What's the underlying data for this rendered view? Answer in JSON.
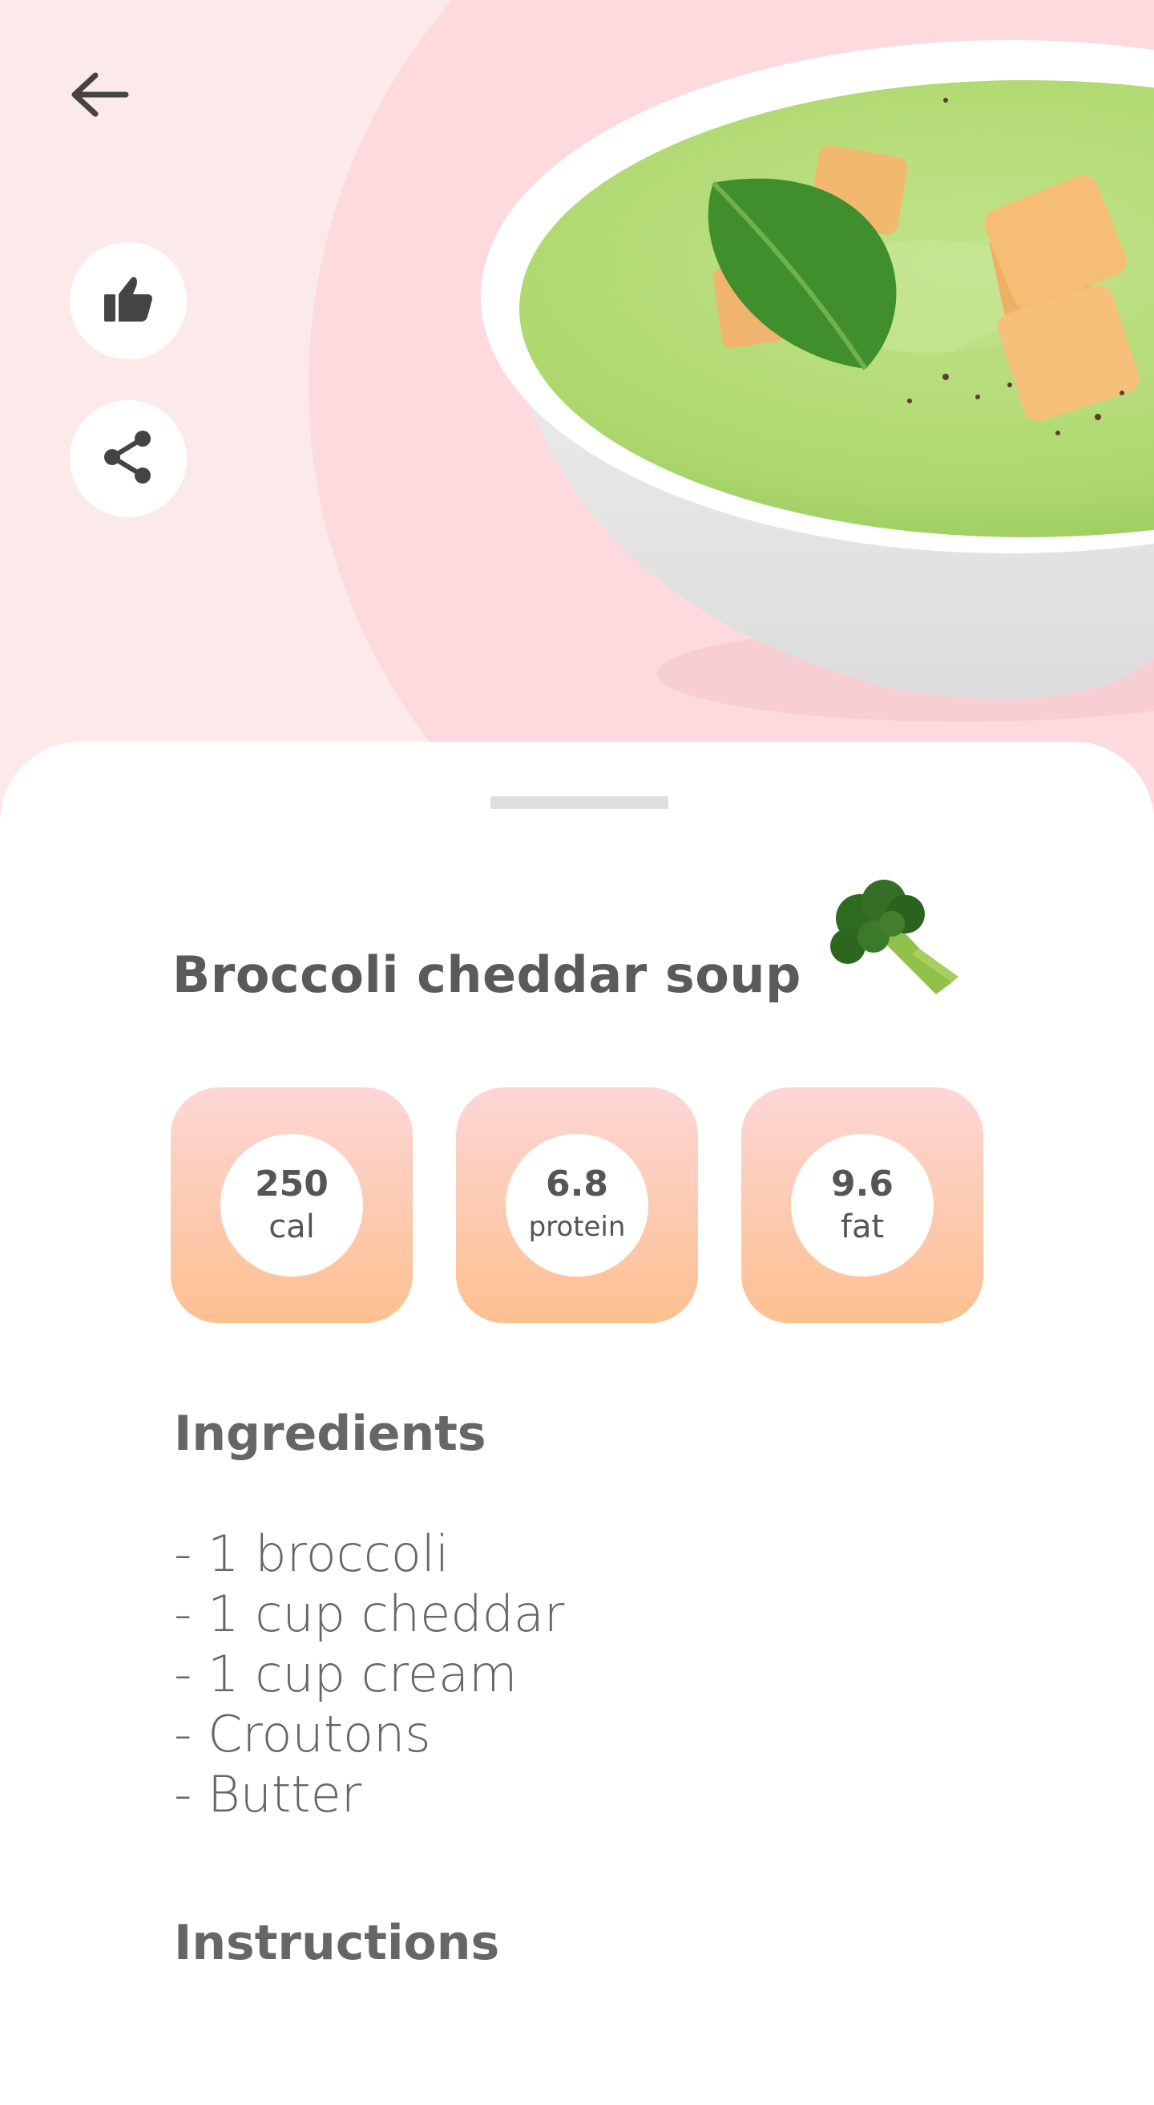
{
  "recipe": {
    "title": "Broccoli cheddar soup",
    "stats": [
      {
        "value": "250",
        "unit": "cal"
      },
      {
        "value": "6.8",
        "unit": "protein"
      },
      {
        "value": "9.6",
        "unit": "fat"
      }
    ]
  },
  "ingredients": {
    "heading": "Ingredients",
    "items": [
      "- 1 broccoli",
      "- 1 cup cheddar",
      "- 1 cup cream",
      "- Croutons",
      "- Butter"
    ]
  },
  "instructions": {
    "heading": "Instructions"
  },
  "icons": {
    "back": "arrow-left-icon",
    "like": "thumbs-up-icon",
    "share": "share-icon",
    "title_icon": "broccoli-icon"
  },
  "colors": {
    "hero_background": "#fce9ea",
    "hero_blob": "#fcdadd",
    "stat_gradient_top": "#fdd6d6",
    "stat_gradient_bottom": "#fdc090",
    "text": "#5a5a5a"
  }
}
